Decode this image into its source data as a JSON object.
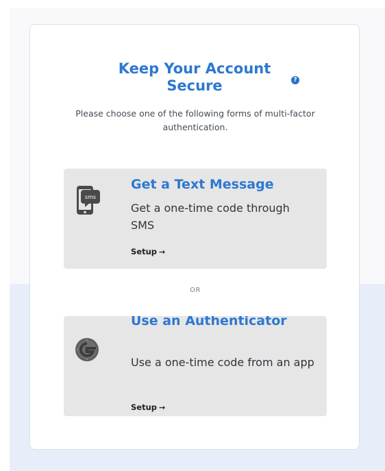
{
  "card": {
    "title": "Keep Your Account Secure",
    "help_icon": "?",
    "subtitle": "Please choose one of the following forms of multi-factor authentication.",
    "separator": "OR"
  },
  "options": [
    {
      "title": "Get a Text Message",
      "description": "Get a one-time code through SMS",
      "setup_label": "Setup",
      "arrow": "→",
      "icon": "sms-phone-icon",
      "icon_label": "sms"
    },
    {
      "title": "Use an Authenticator",
      "description": "Use a one-time code from an app",
      "setup_label": "Setup",
      "arrow": "→",
      "icon": "google-authenticator-icon"
    }
  ],
  "colors": {
    "accent": "#2d78d0",
    "option_bg": "#e6e6e6",
    "page_bg_lower": "#e8eef9",
    "text": "#2f343b"
  }
}
